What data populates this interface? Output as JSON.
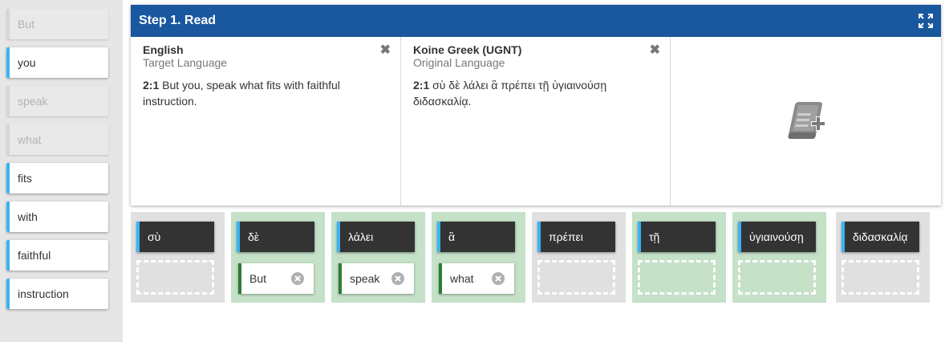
{
  "wordbank": {
    "items": [
      {
        "label": "But",
        "used": true
      },
      {
        "label": "you",
        "used": false
      },
      {
        "label": "speak",
        "used": true
      },
      {
        "label": "what",
        "used": true
      },
      {
        "label": "fits",
        "used": false
      },
      {
        "label": "with",
        "used": false
      },
      {
        "label": "faithful",
        "used": false
      },
      {
        "label": "instruction",
        "used": false
      }
    ]
  },
  "panel": {
    "title": "Step 1. Read",
    "target": {
      "language": "English",
      "subtitle": "Target Language",
      "ref": "2:1",
      "text": "But you, speak what fits with faithful instruction."
    },
    "original": {
      "language": "Koine Greek (UGNT)",
      "subtitle": "Original Language",
      "ref": "2:1",
      "text": "σὺ δὲ λάλει ἃ πρέπει τῇ ὑγιαινούσῃ διδασκαλίᾳ."
    },
    "add_resource_icon": "book-plus-icon"
  },
  "alignments": [
    {
      "greek": "σὺ",
      "aligned": null
    },
    {
      "greek": "δὲ",
      "aligned": "But"
    },
    {
      "greek": "λάλει",
      "aligned": "speak"
    },
    {
      "greek": "ἃ",
      "aligned": "what"
    },
    {
      "greek": "πρέπει",
      "aligned": null
    },
    {
      "greek": "τῇ",
      "aligned": null
    },
    {
      "greek": "ὑγιαινούσῃ",
      "aligned": null
    },
    {
      "greek": "διδασκαλίᾳ",
      "aligned": null
    }
  ],
  "colors": {
    "header": "#19579e",
    "accent_blue": "#3ab4f2",
    "accent_green": "#2e7d32",
    "card_filled": "#c5e1c8",
    "card_empty": "#e0e0e0"
  }
}
